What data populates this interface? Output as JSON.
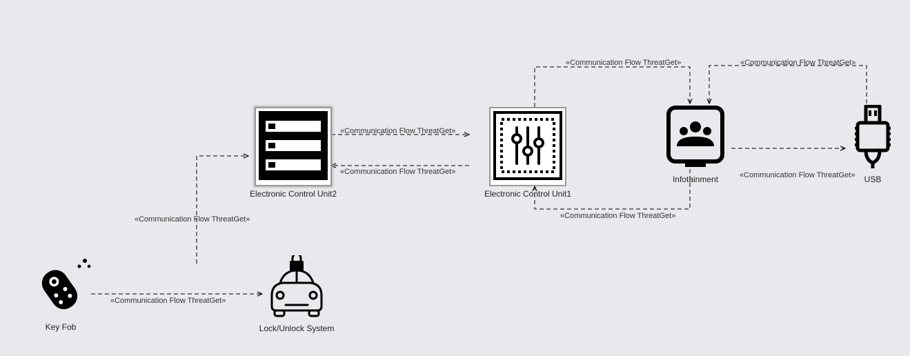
{
  "nodes": {
    "keyfob": {
      "label": "Key Fob"
    },
    "lockunlock": {
      "label": "Lock/Unlock System"
    },
    "ecu2": {
      "label": "Electronic Control Unit2"
    },
    "ecu1": {
      "label": "Electronic Control Unit1"
    },
    "infotainment": {
      "label": "Infotainment"
    },
    "usb": {
      "label": "USB"
    }
  },
  "flow_label": "«Communication Flow ThreatGet»",
  "flows": [
    {
      "id": "f_keyfob_lock",
      "from": "keyfob",
      "to": "lockunlock"
    },
    {
      "id": "f_lock_ecu2",
      "from": "lockunlock",
      "to": "ecu2"
    },
    {
      "id": "f_ecu2_ecu1",
      "from": "ecu2",
      "to": "ecu1"
    },
    {
      "id": "f_ecu1_ecu2",
      "from": "ecu1",
      "to": "ecu2"
    },
    {
      "id": "f_ecu1_info_top",
      "from": "ecu1",
      "to": "infotainment"
    },
    {
      "id": "f_info_ecu1_bot",
      "from": "infotainment",
      "to": "ecu1"
    },
    {
      "id": "f_info_usb",
      "from": "infotainment",
      "to": "usb"
    },
    {
      "id": "f_usb_info",
      "from": "usb",
      "to": "infotainment"
    }
  ]
}
